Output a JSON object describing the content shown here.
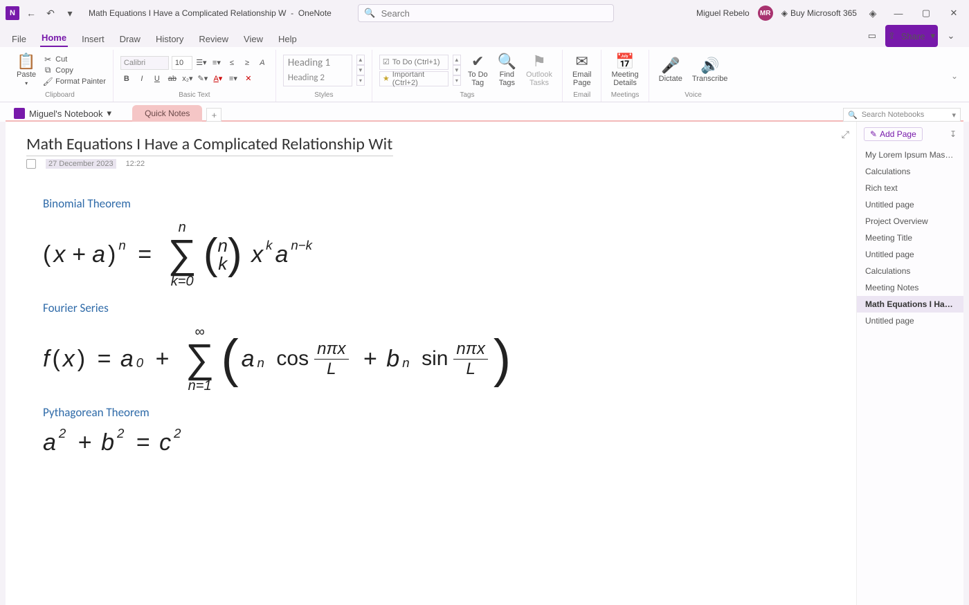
{
  "titlebar": {
    "doc_title": "Math Equations I Have a Complicated Relationship W",
    "app_name": "OneNote",
    "search_placeholder": "Search",
    "user_name": "Miguel Rebelo",
    "user_initials": "MR",
    "buy_label": "Buy Microsoft 365"
  },
  "ribbon_tabs": [
    "File",
    "Home",
    "Insert",
    "Draw",
    "History",
    "Review",
    "View",
    "Help"
  ],
  "share_label": "Share",
  "ribbon": {
    "clipboard": {
      "paste": "Paste",
      "cut": "Cut",
      "copy": "Copy",
      "format_painter": "Format Painter",
      "group": "Clipboard"
    },
    "basic_text": {
      "font_name": "Calibri",
      "font_size": "10",
      "group": "Basic Text"
    },
    "styles": {
      "h1": "Heading 1",
      "h2": "Heading 2",
      "group": "Styles"
    },
    "tags": {
      "todo": "To Do (Ctrl+1)",
      "important": "Important (Ctrl+2)",
      "todo_tag": "To Do Tag",
      "find": "Find Tags",
      "outlook": "Outlook Tasks",
      "group": "Tags"
    },
    "email": {
      "label": "Email Page",
      "group": "Email"
    },
    "meetings": {
      "label": "Meeting Details",
      "group": "Meetings"
    },
    "voice": {
      "dictate": "Dictate",
      "transcribe": "Transcribe",
      "group": "Voice"
    }
  },
  "notebook": {
    "name": "Miguel's Notebook",
    "section": "Quick Notes",
    "search_placeholder": "Search Notebooks"
  },
  "page": {
    "title": "Math Equations I Have a Complicated Relationship With",
    "date": "27 December 2023",
    "time": "12:22",
    "sections": {
      "binomial": "Binomial Theorem",
      "fourier": "Fourier Series",
      "pythag": "Pythagorean Theorem"
    }
  },
  "pagelist": {
    "add": "Add Page",
    "items": [
      "My Lorem Ipsum Mashup",
      "Calculations",
      "Rich text",
      "Untitled page",
      "Project Overview",
      "Meeting Title",
      "Untitled page",
      "Calculations",
      "Meeting Notes",
      "Math Equations I Have a ...",
      "Untitled page"
    ],
    "active_index": 9
  }
}
